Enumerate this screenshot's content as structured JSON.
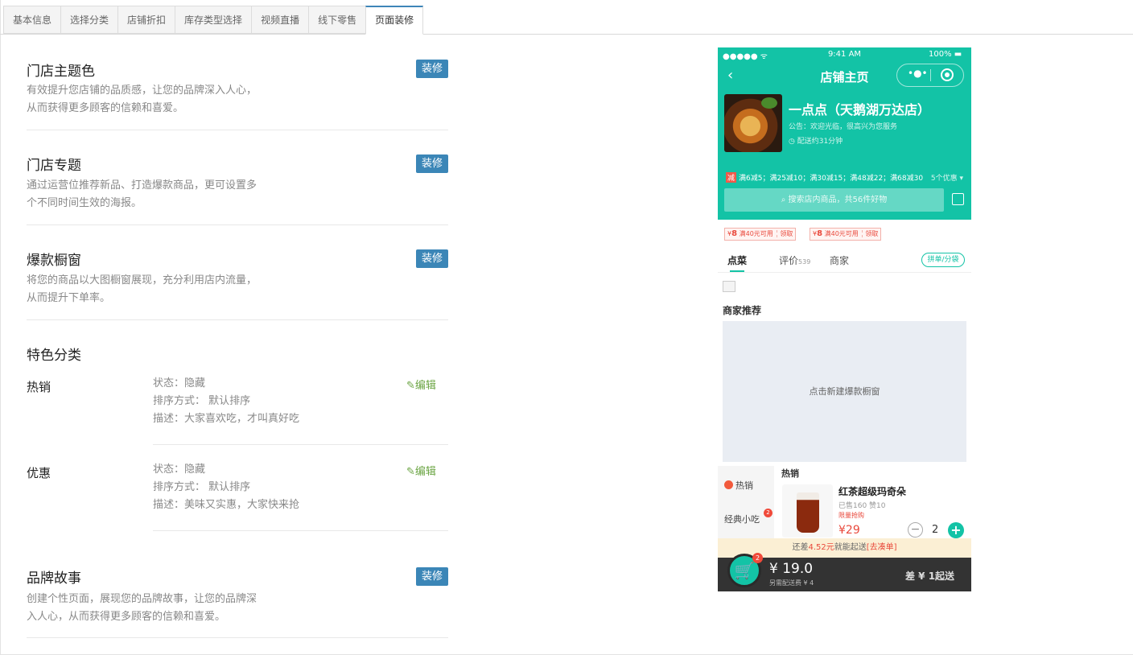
{
  "tabs": [
    "基本信息",
    "选择分类",
    "店铺折扣",
    "库存类型选择",
    "视频直播",
    "线下零售",
    "页面装修"
  ],
  "active_tab_index": 6,
  "deco_label": "装修",
  "edit_label": "编辑",
  "sections": {
    "theme": {
      "title": "门店主题色",
      "desc1": "有效提升您店铺的品质感，让您的品牌深入人心，",
      "desc2": "从而获得更多顾客的信赖和喜爱。"
    },
    "topic": {
      "title": "门店专题",
      "desc1": "通过运营位推荐新品、打造爆款商品，更可设置多",
      "desc2": "个不同时间生效的海报。"
    },
    "window": {
      "title": "爆款橱窗",
      "desc1": "将您的商品以大图橱窗展现，充分利用店内流量，",
      "desc2": "从而提升下单率。"
    },
    "category": {
      "title": "特色分类"
    },
    "brand": {
      "title": "品牌故事",
      "desc1": "创建个性页面，展现您的品牌故事，让您的品牌深",
      "desc2": "入人心，从而获得更多顾客的信赖和喜爱。"
    }
  },
  "categories": [
    {
      "name": "热销",
      "status": "状态：隐藏",
      "sort": "排序方式：  默认排序",
      "desc": "描述：大家喜欢吃，才叫真好吃"
    },
    {
      "name": "优惠",
      "status": "状态：隐藏",
      "sort": "排序方式：  默认排序",
      "desc": "描述：美味又实惠，大家快来抢"
    }
  ],
  "phone": {
    "signal": "●●●●● ᯤ",
    "time": "9:41 AM",
    "battery": "100%",
    "title": "店铺主页",
    "store_name": "一点点（天鹅湖万达店）",
    "notice": "公告：欢迎光临，很高兴为您服务",
    "delivery": "◷ 配送约31分钟",
    "promo_tag": "减",
    "promo": "满6减5；满25减10；满30减15；满48减22；满68减30",
    "promo_more": "5个优惠 ▾",
    "search": "搜索店内商品，共56件好物",
    "coupons": [
      {
        "amount": "8",
        "cond": "满40元可用",
        "get": "领取"
      },
      {
        "amount": "8",
        "cond": "满40元可用",
        "get": "领取"
      }
    ],
    "tab_order": "点菜",
    "tab_review": "评价",
    "review_count": "539",
    "tab_merchant": "商家",
    "pin": "拼单/分袋",
    "recommend": "商家推荐",
    "window_placeholder": "点击新建爆款橱窗",
    "side_hot": "热销",
    "side_snack": "经典小吃",
    "side_badge": "2",
    "hot_title": "热销",
    "product_name": "红茶超级玛奇朵",
    "product_sold": "已售160  赞10",
    "product_limit": "限量抢购",
    "product_price": "¥29",
    "product_qty": "2",
    "tip_pre": "还差",
    "tip_amount": "4.52元",
    "tip_mid": "就能起送",
    "tip_link": "[去凑单]",
    "cart_badge": "2",
    "total": "¥ 19.0",
    "fee": "另需配送费 ¥ 4",
    "start": "差 ¥ 1起送"
  }
}
